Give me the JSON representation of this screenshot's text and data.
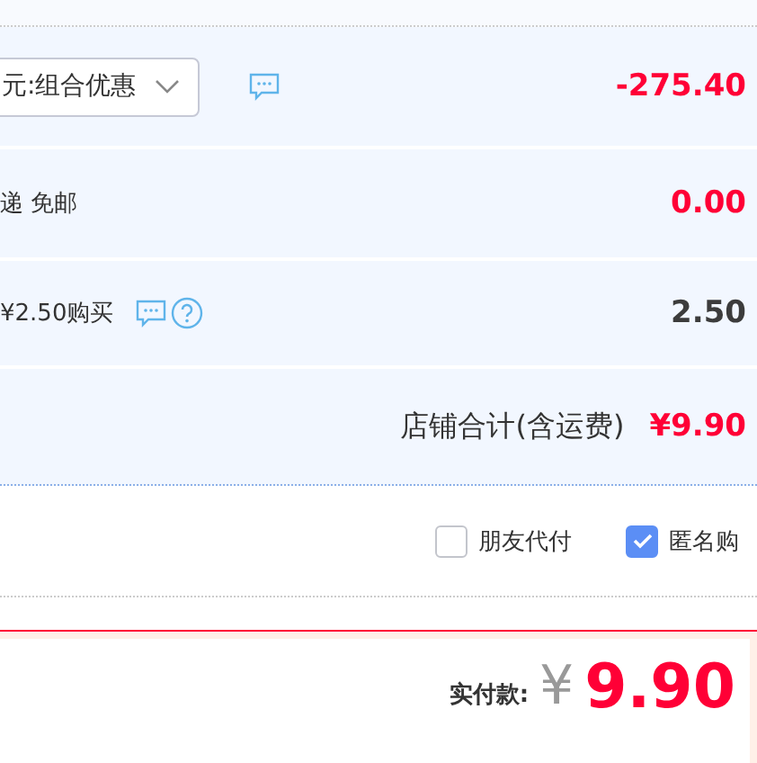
{
  "rows": [
    {
      "kind": "discount",
      "select_value": "元:组合优惠",
      "amount": "-275.40",
      "highlight": true
    },
    {
      "kind": "shipping",
      "label": "递 免邮",
      "amount": "0.00",
      "highlight": true
    },
    {
      "kind": "service",
      "label": "¥2.50购买",
      "amount": "2.50",
      "highlight": false
    }
  ],
  "store_total": {
    "label": "店铺合计(含运费)",
    "amount": "¥9.90"
  },
  "options": [
    {
      "label": "朋友代付",
      "checked": false
    },
    {
      "label": "匿名购",
      "checked": true
    }
  ],
  "payment": {
    "label": "实付款:",
    "currency": "¥",
    "amount": "9.90"
  }
}
